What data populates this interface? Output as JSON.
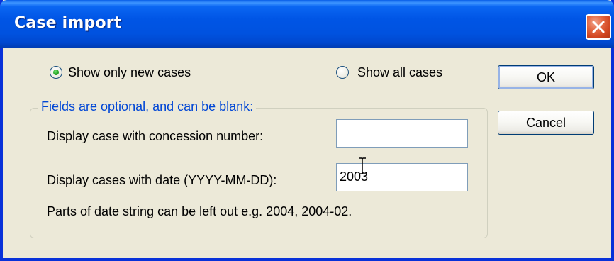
{
  "window": {
    "title": "Case import"
  },
  "options": {
    "show_new": "Show only new cases",
    "show_all": "Show all cases",
    "selected": "show_new"
  },
  "group": {
    "legend": "Fields are optional, and can be blank:",
    "concession_label": "Display case with concession number:",
    "concession_value": "",
    "date_label": "Display cases with date (YYYY-MM-DD):",
    "date_value": "2003",
    "hint": "Parts of date string can be left out e.g. 2004, 2004-02."
  },
  "buttons": {
    "ok": "OK",
    "cancel": "Cancel"
  },
  "colors": {
    "title_bar": "#0055e5",
    "close_button": "#d0441f",
    "legend_text": "#0046d5",
    "dialog_bg": "#ece9d8"
  }
}
